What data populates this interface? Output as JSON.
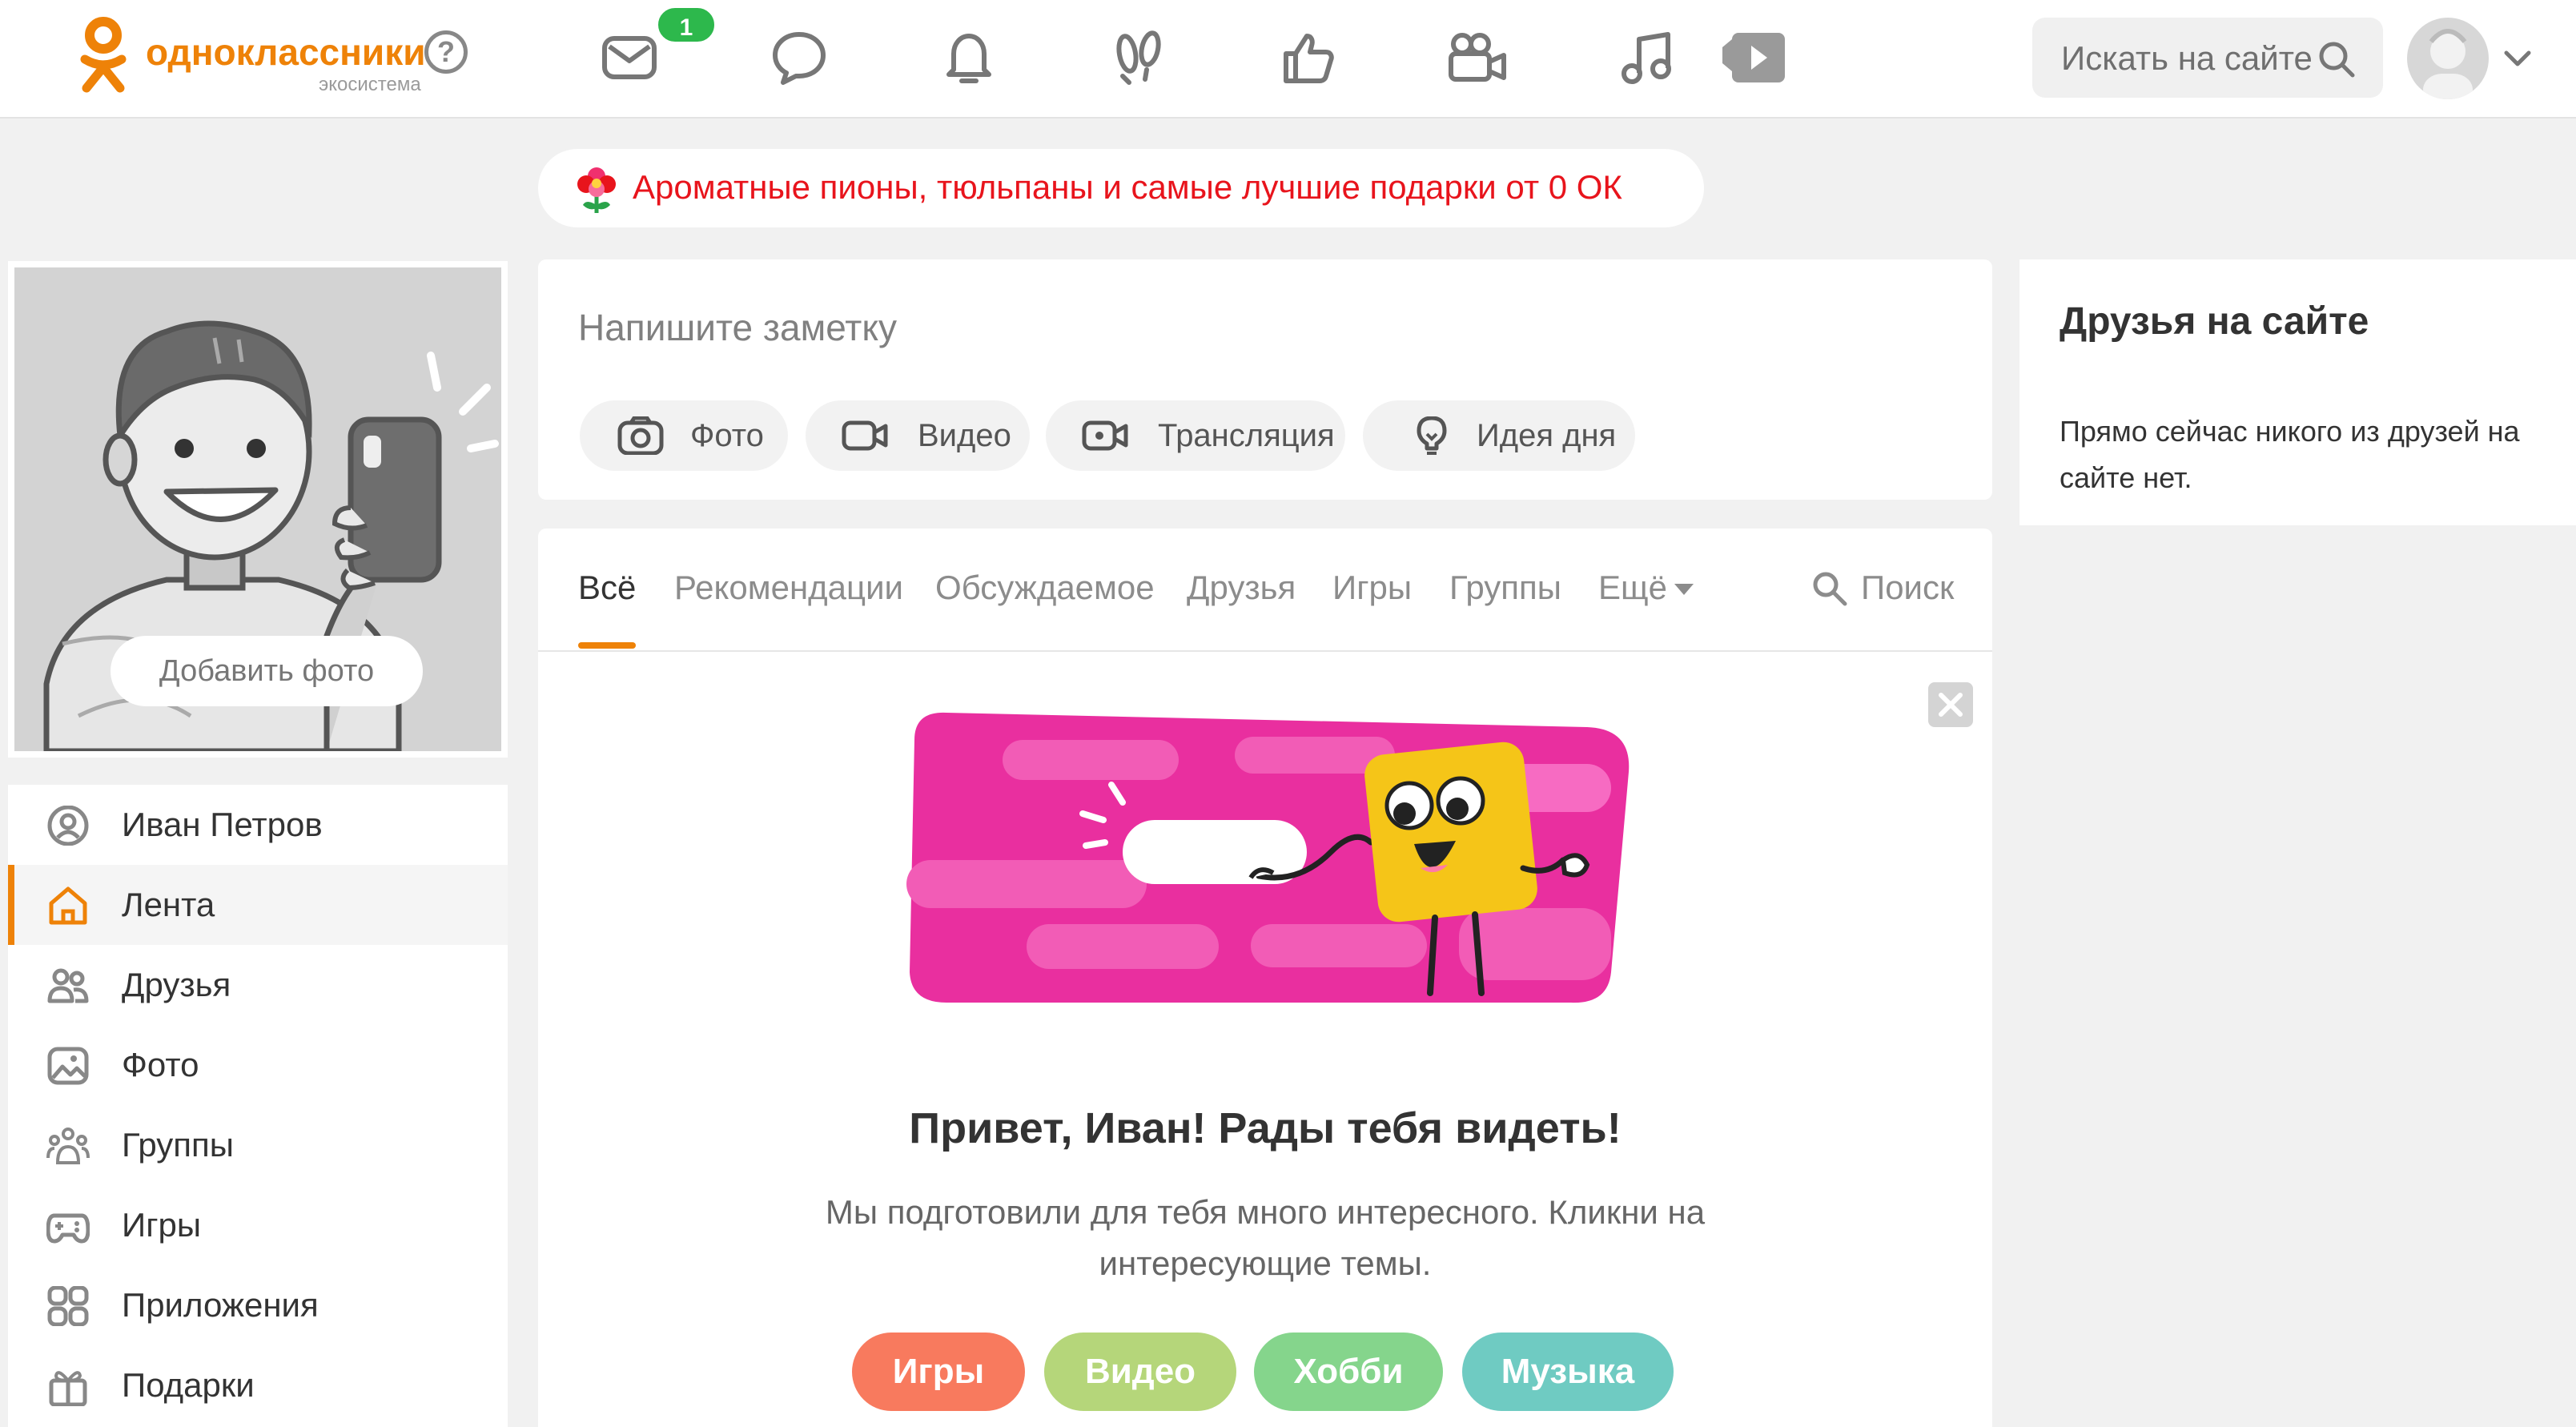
{
  "header": {
    "logo_text": "одноклассники",
    "logo_subtext": "экосистема",
    "messages_badge": "1",
    "search_placeholder": "Искать на сайте",
    "nav_icons": [
      "mail-icon",
      "chat-icon",
      "bell-icon",
      "footprints-icon",
      "like-icon",
      "video-camera-icon",
      "music-icon",
      "video-play-icon"
    ]
  },
  "promo": {
    "text": "Ароматные пионы, тюльпаны и самые лучшие подарки от 0 ОК"
  },
  "profile": {
    "add_photo_label": "Добавить фото"
  },
  "sidebar": {
    "items": [
      {
        "label": "Иван Петров",
        "icon": "user-icon"
      },
      {
        "label": "Лента",
        "icon": "home-icon",
        "active": true
      },
      {
        "label": "Друзья",
        "icon": "friends-icon"
      },
      {
        "label": "Фото",
        "icon": "photo-icon"
      },
      {
        "label": "Группы",
        "icon": "groups-icon"
      },
      {
        "label": "Игры",
        "icon": "gamepad-icon"
      },
      {
        "label": "Приложения",
        "icon": "apps-icon"
      },
      {
        "label": "Подарки",
        "icon": "gift-icon"
      }
    ]
  },
  "composer": {
    "placeholder": "Напишите заметку",
    "buttons": [
      {
        "label": "Фото",
        "icon": "camera-icon"
      },
      {
        "label": "Видео",
        "icon": "video-icon"
      },
      {
        "label": "Трансляция",
        "icon": "stream-icon"
      },
      {
        "label": "Идея дня",
        "icon": "lightbulb-icon"
      }
    ]
  },
  "feed": {
    "tabs": [
      "Всё",
      "Рекомендации",
      "Обсуждаемое",
      "Друзья",
      "Игры",
      "Группы",
      "Ещё"
    ],
    "active_tab": "Всё",
    "search_label": "Поиск",
    "welcome_title": "Привет, Иван! Рады тебя видеть!",
    "welcome_text": "Мы подготовили для тебя много интересного. Кликни на интересующие темы.",
    "topics": [
      {
        "label": "Игры",
        "color": "#f87a5e"
      },
      {
        "label": "Видео",
        "color": "#b5d67a"
      },
      {
        "label": "Хобби",
        "color": "#85d58c"
      },
      {
        "label": "Музыка",
        "color": "#6fcbc2"
      }
    ]
  },
  "friends_online": {
    "title": "Друзья на сайте",
    "text": "Прямо сейчас никого из друзей на сайте нет."
  },
  "colors": {
    "brand_orange": "#ee8208",
    "badge_green": "#2db84c",
    "promo_red": "#e8141c",
    "hero_pink": "#e92f9f",
    "hero_yellow": "#f5c518"
  }
}
